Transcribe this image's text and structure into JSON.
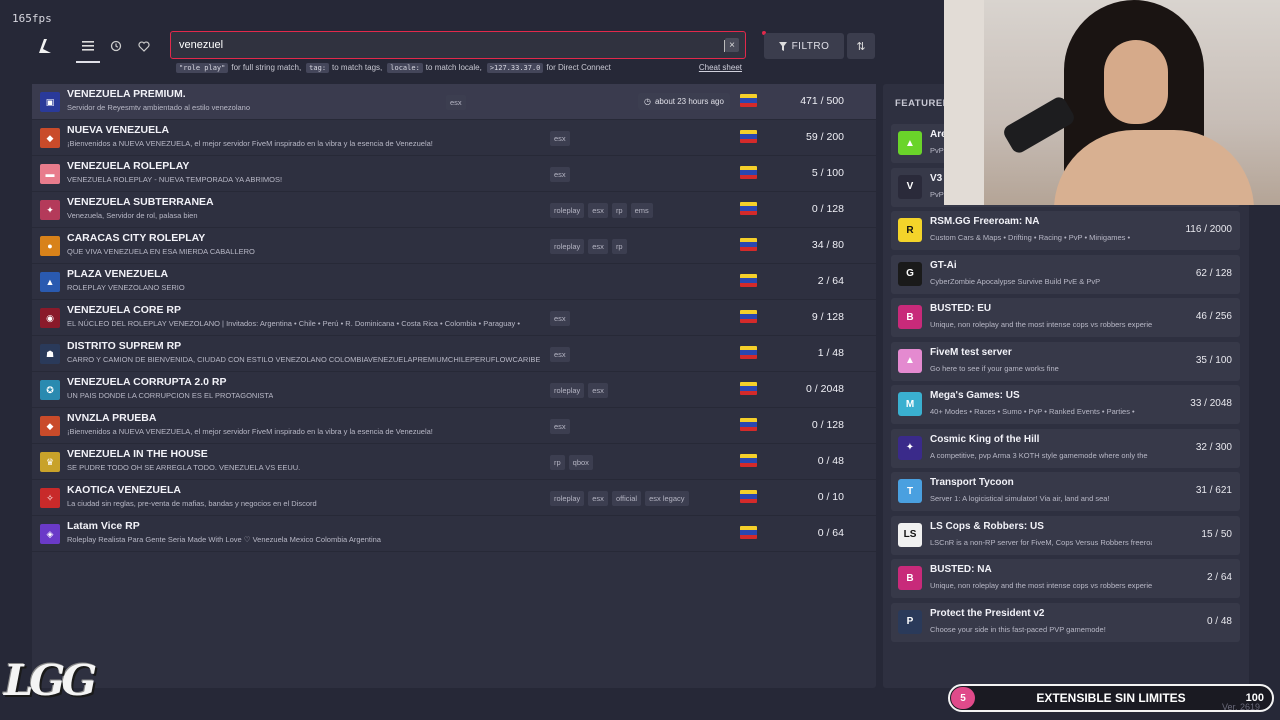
{
  "fps": "165fps",
  "nav": {
    "tabs": [
      "list",
      "history",
      "favorites"
    ]
  },
  "search": {
    "value": "venezuel",
    "clear": "×"
  },
  "hints": [
    {
      "code": "\"role play\"",
      "text": "for full string match,"
    },
    {
      "code": "tag:",
      "text": "to match tags,"
    },
    {
      "code": "locale:",
      "text": "to match locale,"
    },
    {
      "code": ">127.33.37.0",
      "text": "for Direct Connect"
    }
  ],
  "cheat_sheet": "Cheat sheet",
  "filter_label": "FILTRO",
  "sort_icon": "⇅",
  "servers": [
    {
      "name": "VENEZUELA PREMIUM.",
      "desc": "Servidor de Reyesmtv ambientado al estilo venezolano",
      "tags": [
        "esx"
      ],
      "time": "about 23 hours ago",
      "count": "471 / 500",
      "color": "#2a3a9a",
      "glyph": "▣"
    },
    {
      "name": "NUEVA VENEZUELA",
      "desc": "¡Bienvenidos a NUEVA VENEZUELA, el mejor servidor FiveM inspirado en la vibra y la esencia de Venezuela!",
      "tags": [
        "esx"
      ],
      "count": "59 / 200",
      "color": "#c94b2a",
      "glyph": "◆"
    },
    {
      "name": "VENEZUELA ROLEPLAY",
      "desc": "VENEZUELA ROLEPLAY - NUEVA TEMPORADA YA ABRIMOS!",
      "tags": [
        "esx"
      ],
      "count": "5 / 100",
      "color": "#e87c8c",
      "glyph": "▬"
    },
    {
      "name": "VENEZUELA SUBTERRANEA",
      "desc": "Venezuela, Servidor de rol, palasa bien",
      "tags": [
        "roleplay",
        "esx",
        "rp",
        "ems"
      ],
      "count": "0 / 128",
      "color": "#b43a5a",
      "glyph": "✦"
    },
    {
      "name": "CARACAS CITY ROLEPLAY",
      "desc": "QUE VIVA VENEZUELA EN ESA MIERDA CABALLERO",
      "tags": [
        "roleplay",
        "esx",
        "rp"
      ],
      "count": "34 / 80",
      "color": "#d8821a",
      "glyph": "●"
    },
    {
      "name": "PLAZA VENEZUELA",
      "desc": "ROLEPLAY VENEZOLANO SERIO",
      "tags": [],
      "count": "2 / 64",
      "color": "#2a5ab0",
      "glyph": "▲"
    },
    {
      "name": "VENEZUELA CORE RP",
      "desc": "EL NÚCLEO DEL ROLEPLAY VENEZOLANO | Invitados: Argentina • Chile • Perú • R. Dominicana • Costa Rica • Colombia • Paraguay •",
      "tags": [
        "esx"
      ],
      "count": "9 / 128",
      "color": "#8a1a2a",
      "glyph": "◉"
    },
    {
      "name": "DISTRITO SUPREM RP",
      "desc": "CARRO Y CAMION DE BIENVENIDA, CIUDAD CON ESTILO VENEZOLANO COLOMBIAVENEZUELAPREMIUMCHILEPERUFLOWCARIBE",
      "tags": [
        "esx"
      ],
      "count": "1 / 48",
      "color": "#2a3a5a",
      "glyph": "☗"
    },
    {
      "name": "VENEZUELA CORRUPTA 2.0 RP",
      "desc": "UN PAIS DONDE LA CORRUPCION ES EL PROTAGONISTA",
      "tags": [
        "roleplay",
        "esx"
      ],
      "count": "0 / 2048",
      "color": "#2a8ab0",
      "glyph": "✪"
    },
    {
      "name": "NVNZLA PRUEBA",
      "desc": "¡Bienvenidos a NUEVA VENEZUELA, el mejor servidor FiveM inspirado en la vibra y la esencia de Venezuela!",
      "tags": [
        "esx"
      ],
      "count": "0 / 128",
      "color": "#c94b2a",
      "glyph": "◆"
    },
    {
      "name": "VENEZUELA IN THE HOUSE",
      "desc": "SE PUDRE TODO OH SE ARREGLA TODO. VENEZUELA VS EEUU.",
      "tags": [
        "rp",
        "qbox"
      ],
      "count": "0 / 48",
      "color": "#c8a22a",
      "glyph": "♛"
    },
    {
      "name": "KAOTICA VENEZUELA",
      "desc": "La ciudad sin reglas, pre-venta de mafias, bandas y negocios en el Discord",
      "tags": [
        "roleplay",
        "esx",
        "official",
        "esx legacy"
      ],
      "count": "0 / 10",
      "color": "#c82a2a",
      "glyph": "✧"
    },
    {
      "name": "Latam Vice RP",
      "desc": "Roleplay Realista Para Gente Seria Made With Love ♡ Venezuela Mexico Colombia Argentina",
      "tags": [],
      "count": "0 / 64",
      "color": "#6a3ac8",
      "glyph": "◈"
    }
  ],
  "featured": {
    "title": "FEATURED",
    "items": [
      {
        "name": "Are",
        "desc": "PvP",
        "count": "",
        "color": "#6ad42a",
        "glyph": "▲"
      },
      {
        "name": "V3",
        "desc": "PvP",
        "count": "",
        "color": "#2a2a3a",
        "glyph": "V"
      },
      {
        "name": "RSM.GG Freeroam: NA",
        "desc": "Custom Cars & Maps • Drifting • Racing • PvP • Minigames •",
        "count": "116 / 2000",
        "color": "#f4d42a",
        "glyph": "R"
      },
      {
        "name": "GT-Ai",
        "desc": "CyberZombie Apocalypse Survive Build PvE & PvP",
        "count": "62 / 128",
        "color": "#1a1a1a",
        "glyph": "G"
      },
      {
        "name": "BUSTED: EU",
        "desc": "Unique, non roleplay and the most intense cops vs robbers experience",
        "count": "46 / 256",
        "color": "#c82a7a",
        "glyph": "B"
      },
      {
        "name": "FiveM test server",
        "desc": "Go here to see if your game works fine",
        "count": "35 / 100",
        "color": "#e48ad0",
        "glyph": "▲"
      },
      {
        "name": "Mega's Games: US",
        "desc": "40+ Modes • Races • Sumo • PvP • Ranked Events • Parties •",
        "count": "33 / 2048",
        "color": "#3ab0d0",
        "glyph": "M"
      },
      {
        "name": "Cosmic King of the Hill",
        "desc": "A competitive, pvp Arma 3 KOTH style gamemode where only the",
        "count": "32 / 300",
        "color": "#3a2a8a",
        "glyph": "✦"
      },
      {
        "name": "Transport Tycoon",
        "desc": "Server 1: A logicistical simulator! Via air, land and sea!",
        "count": "31 / 621",
        "color": "#4aa0e0",
        "glyph": "T"
      },
      {
        "name": "LS Cops & Robbers: US",
        "desc": "LSCnR is a non-RP server for FiveM, Cops Versus Robbers freeroam",
        "count": "15 / 50",
        "color": "#f0f0f0",
        "glyph": "LS"
      },
      {
        "name": "BUSTED: NA",
        "desc": "Unique, non roleplay and the most intense cops vs robbers experience",
        "count": "2 / 64",
        "color": "#c82a7a",
        "glyph": "B"
      },
      {
        "name": "Protect the President v2",
        "desc": "Choose your side in this fast-paced PVP gamemode!",
        "count": "0 / 48",
        "color": "#2a3a5a",
        "glyph": "P"
      }
    ]
  },
  "promo": {
    "number": "5",
    "label": "EXTENSIBLE SIN LIMITES",
    "goal": "100"
  },
  "brand": "LGG",
  "version": "Ver. 2619"
}
